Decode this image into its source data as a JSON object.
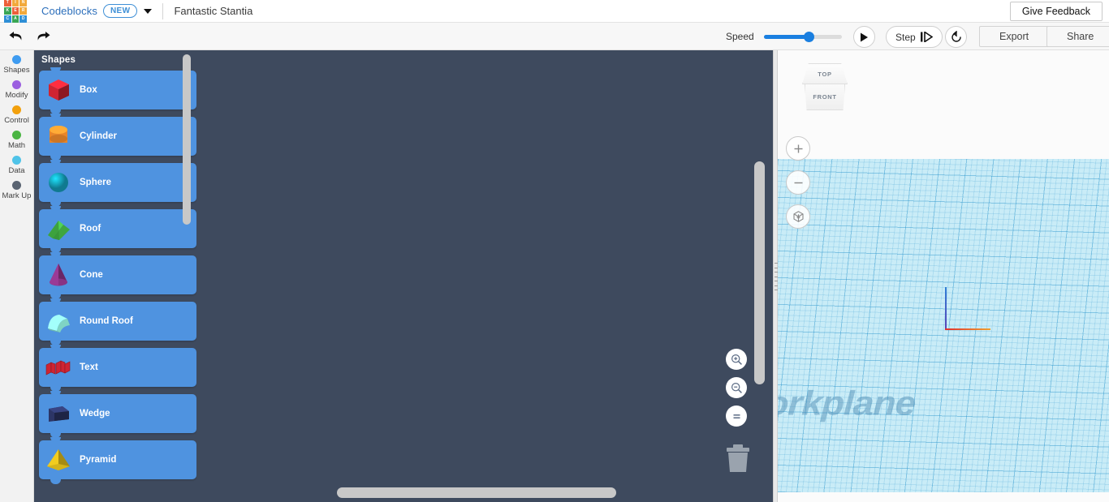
{
  "app": {
    "brand": "Codeblocks",
    "new_badge": "NEW",
    "document_title": "Fantastic Stantia",
    "feedback_label": "Give Feedback",
    "logo_letters": [
      "T",
      "I",
      "N",
      "K",
      "E",
      "R",
      "C",
      "A",
      "D"
    ],
    "logo_colors": [
      "#ec5f3a",
      "#f2a93b",
      "#f2a93b",
      "#3aa655",
      "#ec5f3a",
      "#f2a93b",
      "#2f8fd6",
      "#3aa655",
      "#2f8fd6"
    ]
  },
  "toolbar": {
    "undo_icon": "undo-arrow-icon",
    "redo_icon": "redo-arrow-icon",
    "speed_label": "Speed",
    "speed_value": 59,
    "play_label": "play",
    "step_label": "Step",
    "restart_label": "restart",
    "export_label": "Export",
    "share_label": "Share"
  },
  "sidebar": {
    "items": [
      {
        "label": "Shapes",
        "color": "#3e9bf0",
        "selected": true
      },
      {
        "label": "Modify",
        "color": "#9b5fe0",
        "selected": false
      },
      {
        "label": "Control",
        "color": "#f2a00c",
        "selected": false
      },
      {
        "label": "Math",
        "color": "#4bb543",
        "selected": false
      },
      {
        "label": "Data",
        "color": "#4fc3e8",
        "selected": false
      },
      {
        "label": "Mark Up",
        "color": "#5a6472",
        "selected": false
      }
    ]
  },
  "palette": {
    "title": "Shapes",
    "blocks": [
      {
        "label": "Box",
        "shape": "box-thumbnail",
        "color": "#cf2432"
      },
      {
        "label": "Cylinder",
        "shape": "cylinder-thumbnail",
        "color": "#e8862a"
      },
      {
        "label": "Sphere",
        "shape": "sphere-thumbnail",
        "color": "#18b4d4"
      },
      {
        "label": "Roof",
        "shape": "roof-thumbnail",
        "color": "#3fa63f"
      },
      {
        "label": "Cone",
        "shape": "cone-thumbnail",
        "color": "#9a3a96"
      },
      {
        "label": "Round Roof",
        "shape": "round-roof-thumbnail",
        "color": "#7fd4c4"
      },
      {
        "label": "Text",
        "shape": "text-thumbnail",
        "color": "#cf2432"
      },
      {
        "label": "Wedge",
        "shape": "wedge-thumbnail",
        "color": "#2c3566"
      },
      {
        "label": "Pyramid",
        "shape": "pyramid-thumbnail",
        "color": "#f2cc1e"
      }
    ]
  },
  "workspace": {
    "zoom_in_label": "zoom-in",
    "zoom_out_label": "zoom-out",
    "zoom_fit_label": "zoom-fit",
    "trash_label": "delete"
  },
  "view3d": {
    "cube_top_label": "TOP",
    "cube_front_label": "FRONT",
    "zoom_in_label": "+",
    "zoom_out_label": "−",
    "fit_label": "fit-to-view",
    "workplane_text": "Workplane"
  },
  "colors": {
    "accent_blue": "#1a7fe0",
    "block_blue": "#4f93e0",
    "workspace_bg": "#3e4a5e",
    "workplane": "#c9ecf7"
  }
}
